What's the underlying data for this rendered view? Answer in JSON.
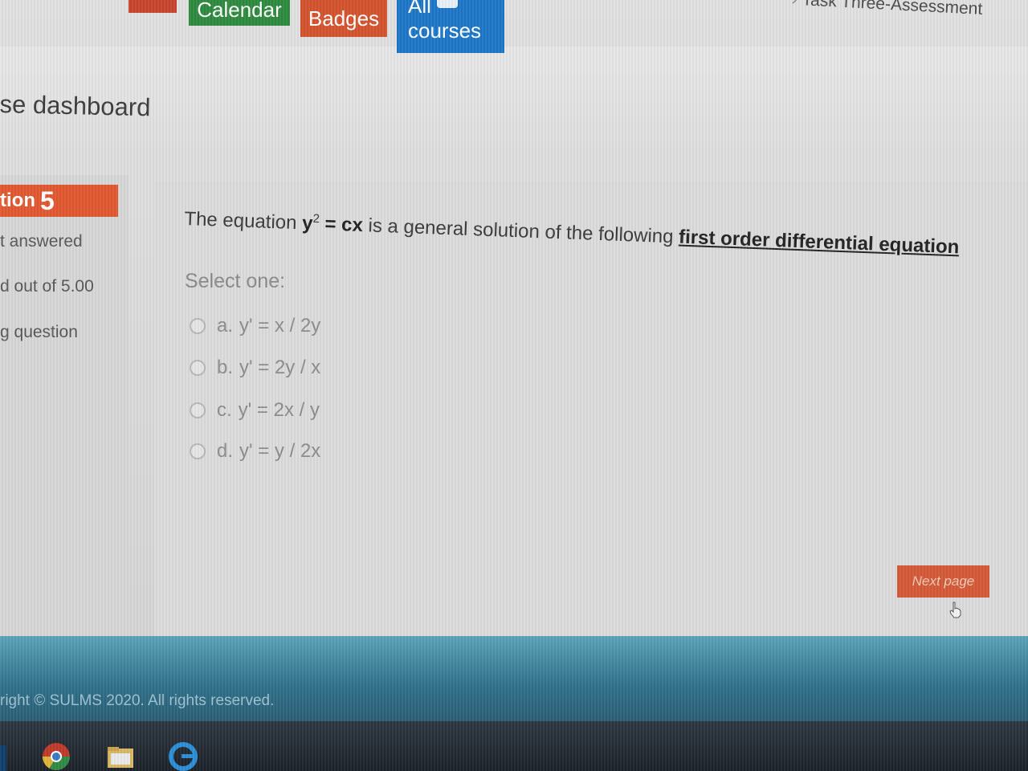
{
  "nav": {
    "calendar_label": "Calendar",
    "badges_label": "Badges",
    "all_courses_label": "All courses",
    "breadcrumb_current": "Task Three-Assessment"
  },
  "header": {
    "dashboard_title": "se dashboard"
  },
  "info": {
    "question_prefix": "tion",
    "question_number": "5",
    "status": "t answered",
    "marks": "d out of 5.00",
    "flag": "g question"
  },
  "question": {
    "intro": "The equation ",
    "equation_lhs": "y",
    "equation_exp": "2",
    "equation_rhs": " = cx",
    "middle": " is a general solution of the following ",
    "term": "first order differential equation",
    "select_one": "Select one:",
    "options": [
      {
        "letter": "a.",
        "text": "y' = x / 2y"
      },
      {
        "letter": "b.",
        "text": "y' = 2y / x"
      },
      {
        "letter": "c.",
        "text": "y' = 2x / y"
      },
      {
        "letter": "d.",
        "text": "y' = y / 2x"
      }
    ],
    "next_label": "Next page"
  },
  "footer": {
    "copyright": "right © SULMS 2020. All rights reserved."
  },
  "colors": {
    "calendar": "#2e8a3e",
    "badges": "#d4532e",
    "all_courses": "#1e77c8",
    "question_badge": "#e2582f",
    "next_button": "#d45a38",
    "footer": "#2f6f8a"
  },
  "icons": {
    "courses": "book-icon",
    "cursor": "hand-pointer-icon",
    "taskbar": [
      "chrome-icon",
      "file-explorer-icon",
      "edge-icon"
    ]
  }
}
